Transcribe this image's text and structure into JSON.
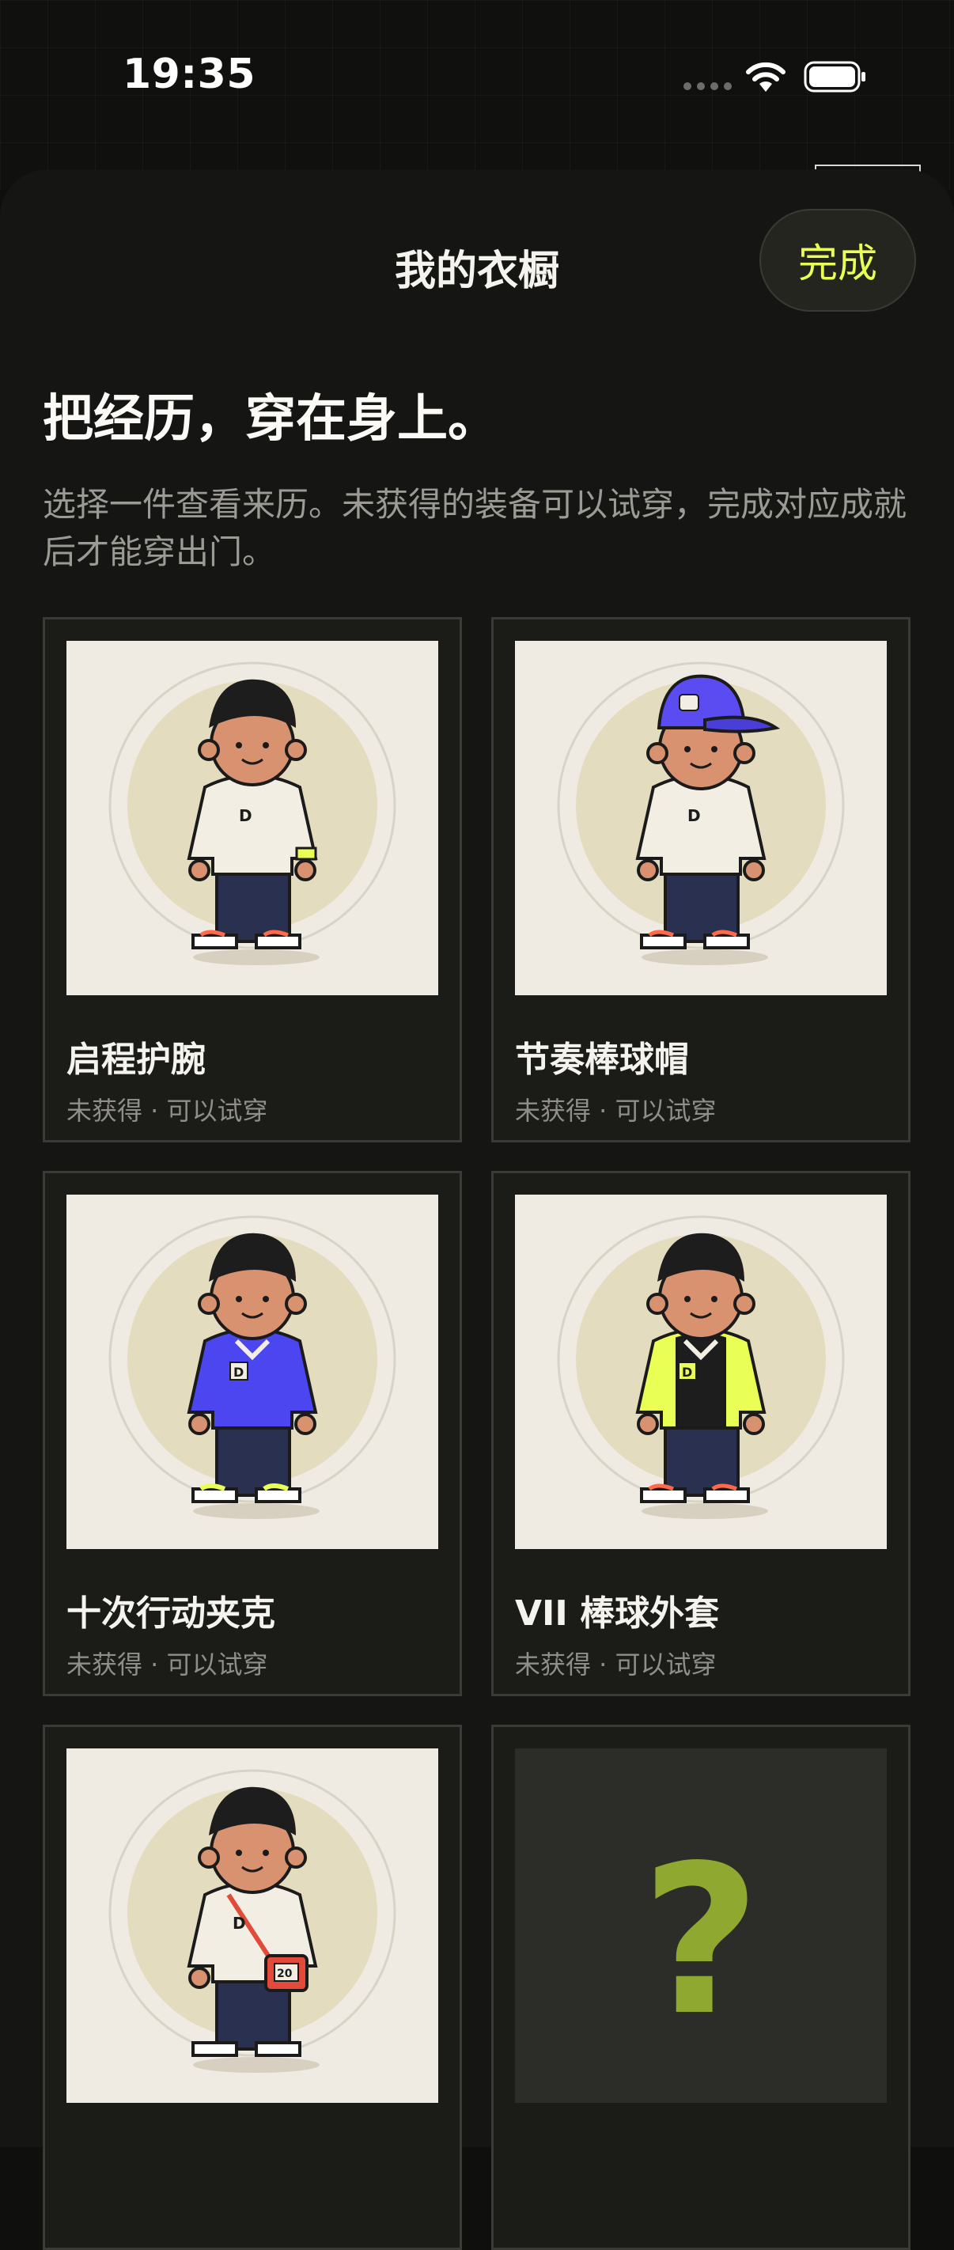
{
  "status_bar": {
    "time": "19:35"
  },
  "header": {
    "title": "我的衣橱",
    "done_label": "完成"
  },
  "headline": "把经历，穿在身上。",
  "subtitle": "选择一件查看来历。未获得的装备可以试穿，完成对应成就后才能穿出门。",
  "colors": {
    "accent": "#e9ff55",
    "sheet_bg": "#151513",
    "card_bg": "#1b1b18",
    "image_bg": "#efebe2"
  },
  "items": [
    {
      "name": "启程护腕",
      "status": "未获得 · 可以试穿",
      "icon": "wristband-avatar"
    },
    {
      "name": "节奏棒球帽",
      "status": "未获得 · 可以试穿",
      "icon": "cap-avatar"
    },
    {
      "name": "十次行动夹克",
      "status": "未获得 · 可以试穿",
      "icon": "blue-jacket-avatar"
    },
    {
      "name": "VII 棒球外套",
      "status": "未获得 · 可以试穿",
      "icon": "varsity-jacket-avatar"
    },
    {
      "name": "",
      "status": "",
      "icon": "crossbody-bag-avatar"
    },
    {
      "name": "",
      "status": "",
      "icon": "locked-question-icon",
      "placeholder": "?"
    }
  ]
}
